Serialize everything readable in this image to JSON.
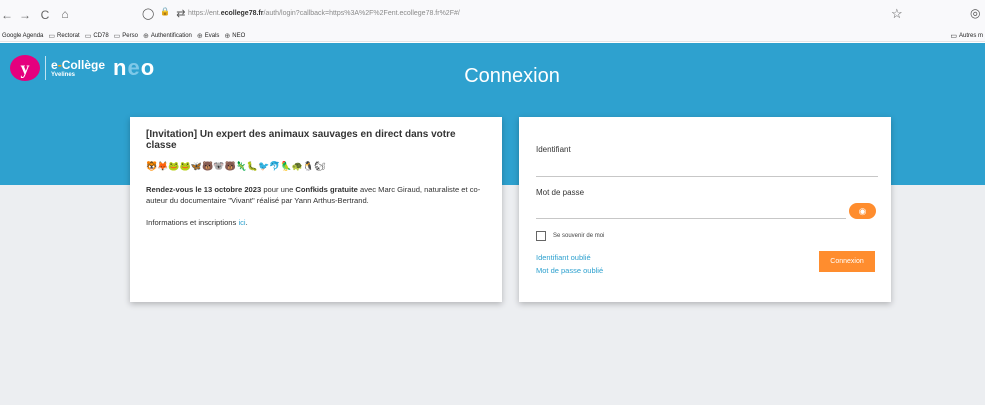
{
  "browser": {
    "back": "←",
    "forward": "→",
    "reload": "C",
    "home": "⌂",
    "shield_icon": "◯",
    "lock_icon": "🔒",
    "perm_icon": "⇄",
    "url_prefix": "https://ent.",
    "url_domain": "ecollege78.fr",
    "url_rest": "/auth/login?callback=https%3A%2F%2Fent.ecollege78.fr%2F#/",
    "star_icon": "☆",
    "right_icon": "◎"
  },
  "bookmarks": {
    "items": [
      {
        "label": "Google Agenda",
        "icon": ""
      },
      {
        "label": "Rectorat",
        "icon": "▭"
      },
      {
        "label": "CD78",
        "icon": "▭"
      },
      {
        "label": "Perso",
        "icon": "▭"
      },
      {
        "label": "Authentification",
        "icon": "⊕"
      },
      {
        "label": "Evals",
        "icon": "⊕"
      },
      {
        "label": "NEO",
        "icon": "⊕"
      }
    ],
    "other": "Autres m",
    "other_icon": "▭"
  },
  "header": {
    "logo_letter": "y",
    "logo_line1_a": "e",
    "logo_line1_dash": "-",
    "logo_line1_b": "Collège",
    "logo_line2": "Yvelines",
    "neo_n": "n",
    "neo_e": "e",
    "neo_o": "o",
    "title": "Connexion"
  },
  "invitation": {
    "title": "[Invitation] Un expert des animaux sauvages en direct dans votre classe",
    "emojis": "🐯🦊🐸🐸🦋🐻🐨🐻🦎🐛🐦🐬🦜🐢🐧🐿",
    "body_part1": "Rendez-vous le 13 octobre 2023",
    "body_part2": " pour une ",
    "body_part3": "Confkids gratuite",
    "body_part4": " avec Marc Giraud, naturaliste et co-auteur du documentaire \"Vivant\" réalisé par Yann Arthus-Bertrand.",
    "info_text": "Informations et inscriptions ",
    "info_link": "ici",
    "info_end": "."
  },
  "login": {
    "identifiant_label": "Identifiant",
    "password_label": "Mot de passe",
    "eye_icon": "◉",
    "remember_label": "Se souvenir de moi",
    "forgot_id": "Identifiant oublié",
    "forgot_password": "Mot de passe oublié",
    "connect_label": "Connexion"
  }
}
